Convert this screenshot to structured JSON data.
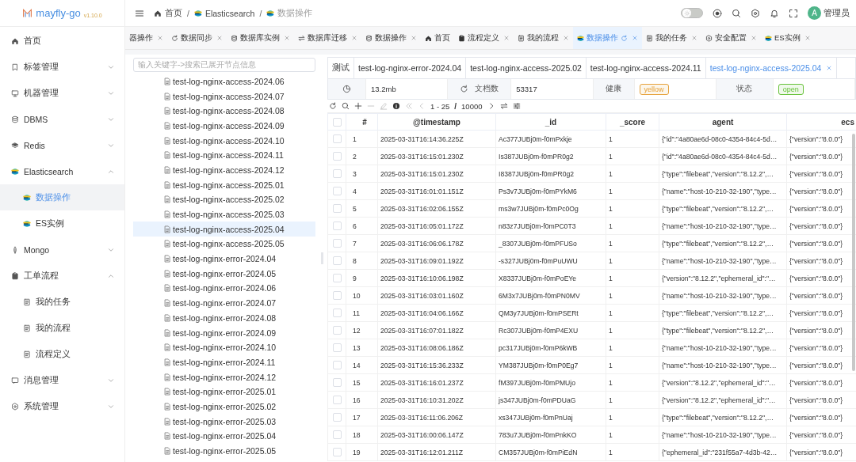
{
  "sidebar": {
    "logo": {
      "name": "mayfly-go",
      "version": "v1.10.0"
    },
    "items": [
      {
        "label": "首页",
        "selected": false
      },
      {
        "label": "标签管理",
        "selected": false,
        "expanded": false
      },
      {
        "label": "机器管理",
        "selected": false,
        "expanded": false
      },
      {
        "label": "DBMS",
        "selected": false,
        "expanded": false
      },
      {
        "label": "Redis",
        "selected": false,
        "expanded": false
      },
      {
        "label": "Elasticsearch",
        "selected": false,
        "expanded": true,
        "children": [
          {
            "label": "数据操作",
            "selected": true
          },
          {
            "label": "ES实例",
            "selected": false
          }
        ]
      },
      {
        "label": "Mongo",
        "selected": false,
        "expanded": false
      },
      {
        "label": "工单流程",
        "selected": false,
        "expanded": true,
        "children": [
          {
            "label": "我的任务",
            "selected": false
          },
          {
            "label": "我的流程",
            "selected": false
          },
          {
            "label": "流程定义",
            "selected": false
          }
        ]
      },
      {
        "label": "消息管理",
        "selected": false,
        "expanded": false
      },
      {
        "label": "系统管理",
        "selected": false,
        "expanded": false
      }
    ]
  },
  "header": {
    "breadcrumbs": [
      "首页",
      "Elasticsearch",
      "数据操作"
    ],
    "separators": [
      "/",
      "/"
    ],
    "theme_toggle": {
      "on": false
    },
    "user": {
      "avatar": "A",
      "name": "管理员"
    }
  },
  "tabs": [
    {
      "label": "器操作",
      "closable": true,
      "selected": false
    },
    {
      "label": "数据同步",
      "closable": true,
      "selected": false
    },
    {
      "label": "数据库实例",
      "closable": true,
      "selected": false
    },
    {
      "label": "数据库迁移",
      "closable": true,
      "selected": false
    },
    {
      "label": "数据操作",
      "closable": true,
      "selected": false
    },
    {
      "label": "首页",
      "closable": false,
      "selected": false
    },
    {
      "label": "流程定义",
      "closable": true,
      "selected": false
    },
    {
      "label": "我的流程",
      "closable": true,
      "selected": false
    },
    {
      "label": "数据操作",
      "closable": true,
      "selected": true
    },
    {
      "label": "我的任务",
      "closable": true,
      "selected": false
    },
    {
      "label": "安全配置",
      "closable": true,
      "selected": false
    },
    {
      "label": "ES实例",
      "closable": true,
      "selected": false
    }
  ],
  "tree": {
    "placeholder": "输入关键字->搜索已展开节点信息",
    "items": [
      {
        "label": "test-log-nginx-access-2024.06",
        "selected": false
      },
      {
        "label": "test-log-nginx-access-2024.07",
        "selected": false
      },
      {
        "label": "test-log-nginx-access-2024.08",
        "selected": false
      },
      {
        "label": "test-log-nginx-access-2024.09",
        "selected": false
      },
      {
        "label": "test-log-nginx-access-2024.10",
        "selected": false
      },
      {
        "label": "test-log-nginx-access-2024.11",
        "selected": false
      },
      {
        "label": "test-log-nginx-access-2024.12",
        "selected": false
      },
      {
        "label": "test-log-nginx-access-2025.01",
        "selected": false
      },
      {
        "label": "test-log-nginx-access-2025.02",
        "selected": false
      },
      {
        "label": "test-log-nginx-access-2025.03",
        "selected": false
      },
      {
        "label": "test-log-nginx-access-2025.04",
        "selected": true
      },
      {
        "label": "test-log-nginx-access-2025.05",
        "selected": false
      },
      {
        "label": "test-log-nginx-error-2024.04",
        "selected": false
      },
      {
        "label": "test-log-nginx-error-2024.05",
        "selected": false
      },
      {
        "label": "test-log-nginx-error-2024.06",
        "selected": false
      },
      {
        "label": "test-log-nginx-error-2024.07",
        "selected": false
      },
      {
        "label": "test-log-nginx-error-2024.08",
        "selected": false
      },
      {
        "label": "test-log-nginx-error-2024.09",
        "selected": false
      },
      {
        "label": "test-log-nginx-error-2024.10",
        "selected": false
      },
      {
        "label": "test-log-nginx-error-2024.11",
        "selected": false
      },
      {
        "label": "test-log-nginx-error-2024.12",
        "selected": false
      },
      {
        "label": "test-log-nginx-error-2025.01",
        "selected": false
      },
      {
        "label": "test-log-nginx-error-2025.02",
        "selected": false
      },
      {
        "label": "test-log-nginx-error-2025.03",
        "selected": false
      },
      {
        "label": "test-log-nginx-error-2025.04",
        "selected": false
      },
      {
        "label": "test-log-nginx-error-2025.05",
        "selected": false
      }
    ]
  },
  "index_tabs": {
    "prefix": "测试",
    "tabs": [
      {
        "label": "test-log-nginx-error-2024.04",
        "selected": false
      },
      {
        "label": "test-log-nginx-access-2025.02",
        "selected": false
      },
      {
        "label": "test-log-nginx-access-2024.11",
        "selected": false
      },
      {
        "label": "test-log-nginx-access-2025.04",
        "selected": true
      }
    ]
  },
  "stats": {
    "size": "13.2mb",
    "docs_label": "文档数",
    "docs": "53317",
    "health_label": "健康",
    "health": {
      "text": "yellow",
      "color": "#e6a23c"
    },
    "status_label": "状态",
    "status": {
      "text": "open",
      "color": "#67c23a"
    }
  },
  "toolbar": {
    "range": "1 - 25",
    "separator": "/",
    "total": "10000"
  },
  "table": {
    "header_checked": false,
    "columns": [
      "#",
      "@timestamp",
      "_id",
      "_score",
      "agent",
      "ecs"
    ],
    "rows": [
      {
        "checked": false,
        "cells": [
          "1",
          "2025-03-31T16:14:36.225Z",
          "Ac377JUBj0m-f0mPxkje",
          "1",
          "{\"id\":\"4a80ae6d-08c0-4354-84c4-5d…",
          "{\"version\":\"8.0.0\"}"
        ]
      },
      {
        "checked": false,
        "cells": [
          "2",
          "2025-03-31T16:15:01.230Z",
          "Is387JUBj0m-f0mPR0g2",
          "1",
          "{\"id\":\"4a80ae6d-08c0-4354-84c4-5d…",
          "{\"version\":\"8.0.0\"}"
        ]
      },
      {
        "checked": false,
        "cells": [
          "3",
          "2025-03-31T16:15:01.230Z",
          "I8387JUBj0m-f0mPR0g2",
          "1",
          "{\"type\":\"filebeat\",\"version\":\"8.12.2\",…",
          "{\"version\":\"8.0.0\"}"
        ]
      },
      {
        "checked": false,
        "cells": [
          "4",
          "2025-03-31T16:01:01.151Z",
          "Ps3v7JUBj0m-f0mPYkM6",
          "1",
          "{\"name\":\"host-10-210-32-190\",\"type…",
          "{\"version\":\"8.0.0\"}"
        ]
      },
      {
        "checked": false,
        "cells": [
          "5",
          "2025-03-31T16:02:06.155Z",
          "ms3w7JUBj0m-f0mPc0Og",
          "1",
          "{\"type\":\"filebeat\",\"version\":\"8.12.2\",…",
          "{\"version\":\"8.0.0\"}"
        ]
      },
      {
        "checked": false,
        "cells": [
          "6",
          "2025-03-31T16:05:01.172Z",
          "n83z7JUBj0m-f0mPC0T3",
          "1",
          "{\"name\":\"host-10-210-32-190\",\"type…",
          "{\"version\":\"8.0.0\"}"
        ]
      },
      {
        "checked": false,
        "cells": [
          "7",
          "2025-03-31T16:06:06.178Z",
          "_8307JUBj0m-f0mPFUSo",
          "1",
          "{\"type\":\"filebeat\",\"version\":\"8.12.2\",…",
          "{\"version\":\"8.0.0\"}"
        ]
      },
      {
        "checked": false,
        "cells": [
          "8",
          "2025-03-31T16:09:01.192Z",
          "-s327JUBj0m-f0mPuUWU",
          "1",
          "{\"name\":\"host-10-210-32-190\",\"type…",
          "{\"version\":\"8.0.0\"}"
        ]
      },
      {
        "checked": false,
        "cells": [
          "9",
          "2025-03-31T16:10:06.198Z",
          "X8337JUBj0m-f0mPoEYe",
          "1",
          "{\"version\":\"8.12.2\",\"ephemeral_id\":\"…",
          "{\"version\":\"8.0.0\"}"
        ]
      },
      {
        "checked": false,
        "cells": [
          "10",
          "2025-03-31T16:03:01.160Z",
          "6M3x7JUBj0m-f0mPN0MV",
          "1",
          "{\"name\":\"host-10-210-32-190\",\"type…",
          "{\"version\":\"8.0.0\"}"
        ]
      },
      {
        "checked": false,
        "cells": [
          "11",
          "2025-03-31T16:04:06.166Z",
          "QM3y7JUBj0m-f0mPSERt",
          "1",
          "{\"type\":\"filebeat\",\"version\":\"8.12.2\",…",
          "{\"version\":\"8.0.0\"}"
        ]
      },
      {
        "checked": false,
        "cells": [
          "12",
          "2025-03-31T16:07:01.182Z",
          "Rc307JUBj0m-f0mP4EXU",
          "1",
          "{\"type\":\"filebeat\",\"version\":\"8.12.2\",…",
          "{\"version\":\"8.0.0\"}"
        ]
      },
      {
        "checked": false,
        "cells": [
          "13",
          "2025-03-31T16:08:06.186Z",
          "pc317JUBj0m-f0mP6kWB",
          "1",
          "{\"name\":\"host-10-210-32-190\",\"type…",
          "{\"version\":\"8.0.0\"}"
        ]
      },
      {
        "checked": false,
        "cells": [
          "14",
          "2025-03-31T16:15:36.233Z",
          "YM387JUBj0m-f0mP0Eg7",
          "1",
          "{\"name\":\"host-10-210-32-190\",\"type…",
          "{\"version\":\"8.0.0\"}"
        ]
      },
      {
        "checked": false,
        "cells": [
          "15",
          "2025-03-31T16:16:01.237Z",
          "fM397JUBj0m-f0mPMUjo",
          "1",
          "{\"version\":\"8.12.2\",\"ephemeral_id\":\"…",
          "{\"version\":\"8.0.0\"}"
        ]
      },
      {
        "checked": false,
        "cells": [
          "16",
          "2025-03-31T16:10:31.202Z",
          "js347JUBj0m-f0mPDUaG",
          "1",
          "{\"version\":\"8.12.2\",\"ephemeral_id\":\"…",
          "{\"version\":\"8.0.0\"}"
        ]
      },
      {
        "checked": false,
        "cells": [
          "17",
          "2025-03-31T16:11:06.206Z",
          "xs347JUBj0m-f0mPnUaj",
          "1",
          "{\"type\":\"filebeat\",\"version\":\"8.12.2\",…",
          "{\"version\":\"8.0.0\"}"
        ]
      },
      {
        "checked": false,
        "cells": [
          "18",
          "2025-03-31T16:00:06.147Z",
          "783u7JUBj0m-f0mPnkKO",
          "1",
          "{\"name\":\"host-10-210-32-190\",\"type…",
          "{\"version\":\"8.0.0\"}"
        ]
      },
      {
        "checked": false,
        "cells": [
          "19",
          "2025-03-31T16:12:01.211Z",
          "CM357JUBj0m-f0mPiEdN",
          "1",
          "{\"ephemeral_id\":\"231f55a7-4d3b-42…",
          "{\"version\":\"8.0.0\"}"
        ]
      }
    ]
  }
}
